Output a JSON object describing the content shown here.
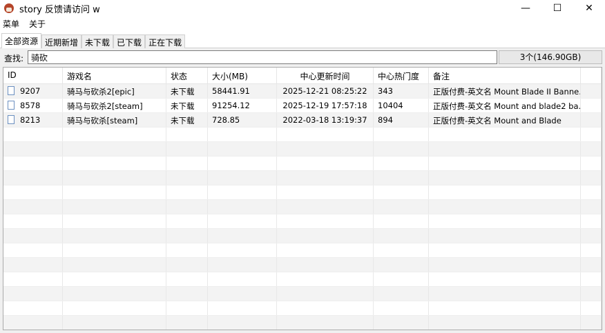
{
  "window": {
    "title": "story 反馈请访问 w",
    "min": "—",
    "max": "☐",
    "close": "✕"
  },
  "menu": [
    "菜单",
    "关于"
  ],
  "tabs": [
    "全部资源",
    "近期新增",
    "未下载",
    "已下载",
    "正在下载"
  ],
  "search": {
    "label": "查找:",
    "value": "骑砍",
    "count": "3个(146.90GB)"
  },
  "columns": [
    "ID",
    "游戏名",
    "状态",
    "大小(MB)",
    "中心更新时间",
    "中心热门度",
    "备注"
  ],
  "rows": [
    [
      "9207",
      "骑马与砍杀2[epic]",
      "未下载",
      "58441.91",
      "2025-12-21 08:25:22",
      "343",
      "正版付费-英文名 Mount Blade II Banne..."
    ],
    [
      "8578",
      "骑马与砍杀2[steam]",
      "未下载",
      "91254.12",
      "2025-12-19 17:57:18",
      "10404",
      "正版付费-英文名 Mount and blade2 ba..."
    ],
    [
      "8213",
      "骑马与砍杀[steam]",
      "未下载",
      "728.85",
      "2022-03-18 13:19:37",
      "894",
      "正版付费-英文名 Mount and Blade"
    ]
  ]
}
